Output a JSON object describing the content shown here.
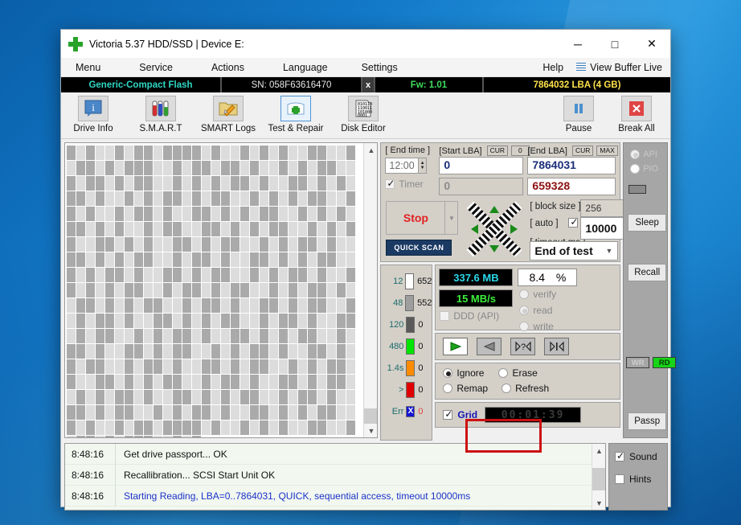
{
  "window": {
    "title": "Victoria 5.37 HDD/SSD | Device E:",
    "app_icon": "green-cross-icon",
    "minimize": "─",
    "maximize": "□",
    "close": "✕"
  },
  "menubar": {
    "items": [
      "Menu",
      "Service",
      "Actions",
      "Language",
      "Settings"
    ],
    "help": "Help",
    "view_buffer_live": "View Buffer Live"
  },
  "drive_strip": {
    "model": "Generic-Compact Flash",
    "serial": "SN: 058F63616470",
    "close_mark": "x",
    "firmware": "Fw: 1.01",
    "capacity": "7864032 LBA (4 GB)"
  },
  "toolbar": {
    "buttons": [
      {
        "label": "Drive Info",
        "icon": "info-icon",
        "selected": false
      },
      {
        "label": "S.M.A.R.T",
        "icon": "test-tubes-icon",
        "selected": false
      },
      {
        "label": "SMART Logs",
        "icon": "folder-pencil-icon",
        "selected": false
      },
      {
        "label": "Test & Repair",
        "icon": "first-aid-kit-icon",
        "selected": true
      },
      {
        "label": "Disk Editor",
        "icon": "binary-page-icon",
        "selected": false
      }
    ],
    "right_buttons": [
      {
        "label": "Pause",
        "icon": "pause-icon"
      },
      {
        "label": "Break All",
        "icon": "red-x-icon"
      }
    ]
  },
  "scan_controls": {
    "end_time_label": "[ End time ]",
    "end_time_value": "12:00",
    "timer_label": "Timer",
    "timer_checked": true,
    "timer_value": "0",
    "start_lba_label": "[Start LBA]",
    "start_lba_cur": "CUR",
    "start_lba_zero": "0",
    "start_lba_value": "0",
    "end_lba_label": "[End LBA]",
    "end_lba_cur": "CUR",
    "end_lba_max": "MAX",
    "end_lba_value": "7864031",
    "current_lba_value": "659328",
    "stop_button": "Stop",
    "quick_scan_button": "QUICK SCAN",
    "block_size_label": "[ block size ]",
    "block_size_value": "256",
    "auto_label": "[ auto ]",
    "auto_checked": true,
    "timeout_label": "[ timeout,ms ]",
    "timeout_value": "10000",
    "end_of_test_value": "End of test"
  },
  "legend": {
    "rows": [
      {
        "threshold": "12",
        "color": "#ffffff",
        "count": "652"
      },
      {
        "threshold": "48",
        "color": "#9e9e9e",
        "count": "552"
      },
      {
        "threshold": "120",
        "color": "#5a5a5a",
        "count": "0"
      },
      {
        "threshold": "480",
        "color": "#00e400",
        "count": "0"
      },
      {
        "threshold": "1.4s",
        "color": "#ff8c00",
        "count": "0"
      },
      {
        "threshold": ">",
        "color": "#e00000",
        "count": "0"
      }
    ],
    "err_label": "Err",
    "err_marker": "X",
    "err_count": "0"
  },
  "stats": {
    "processed": "337.6 MB",
    "percent": "8.4",
    "percent_sign": "%",
    "speed": "15 MB/s",
    "ddd_api_label": "DDD (API)",
    "ddd_api_checked": false,
    "modes": [
      {
        "label": "verify",
        "selected": false
      },
      {
        "label": "read",
        "selected": true
      },
      {
        "label": "write",
        "selected": false
      }
    ],
    "nav_buttons": [
      {
        "name": "play-forward",
        "glyph": "▶",
        "active": true
      },
      {
        "name": "play-backward",
        "glyph": "◀",
        "active": false
      },
      {
        "name": "scan-unknown",
        "glyph": "?",
        "active": false
      },
      {
        "name": "step",
        "glyph": "|",
        "active": false
      }
    ],
    "actions": [
      {
        "label": "Ignore",
        "selected": true
      },
      {
        "label": "Erase",
        "selected": false
      },
      {
        "label": "Remap",
        "selected": false
      },
      {
        "label": "Refresh",
        "selected": false
      }
    ],
    "grid_label": "Grid",
    "grid_checked": true,
    "elapsed": "00:01:39"
  },
  "right_panel": {
    "api_label": "API",
    "api_selected": false,
    "pio_label": "PIO",
    "pio_selected": false,
    "sleep_button": "Sleep",
    "recall_button": "Recall",
    "wr_badge": "WR",
    "rd_badge": "RD",
    "passp_button": "Passp"
  },
  "log": {
    "rows": [
      {
        "time": "8:48:16",
        "message": "Get drive passport... OK",
        "highlight": false
      },
      {
        "time": "8:48:16",
        "message": "Recallibration... SCSI  Start Unit OK",
        "highlight": false
      },
      {
        "time": "8:48:16",
        "message": "Starting Reading, LBA=0..7864031, QUICK, sequential access, timeout 10000ms",
        "highlight": true
      }
    ]
  },
  "log_options": {
    "sound_label": "Sound",
    "sound_checked": true,
    "hints_label": "Hints",
    "hints_checked": false
  },
  "map": {
    "columns": 30,
    "full_rows": 19,
    "last_row_blocks": 14,
    "light_color": "#dcdcdc",
    "dark_color": "#aaaaaa",
    "pattern": "101001011011110100101010011001011010111001011011010010101100101101011001010101101001101010110100101011010110010101011001101001011010011010101100101010110101001011001101010110010101100110101001101011001010110100110101011001011010011010101100101011010011010110010101101001101010110010110101100101011010011010101100101101001101011001010110100110101011001011010011010110010101101001101010110010110100110101100101011010011010101100101101001101011001010110100110101011001011010011010110010101101001101010110010110100110101100101011010011010101100"
  }
}
